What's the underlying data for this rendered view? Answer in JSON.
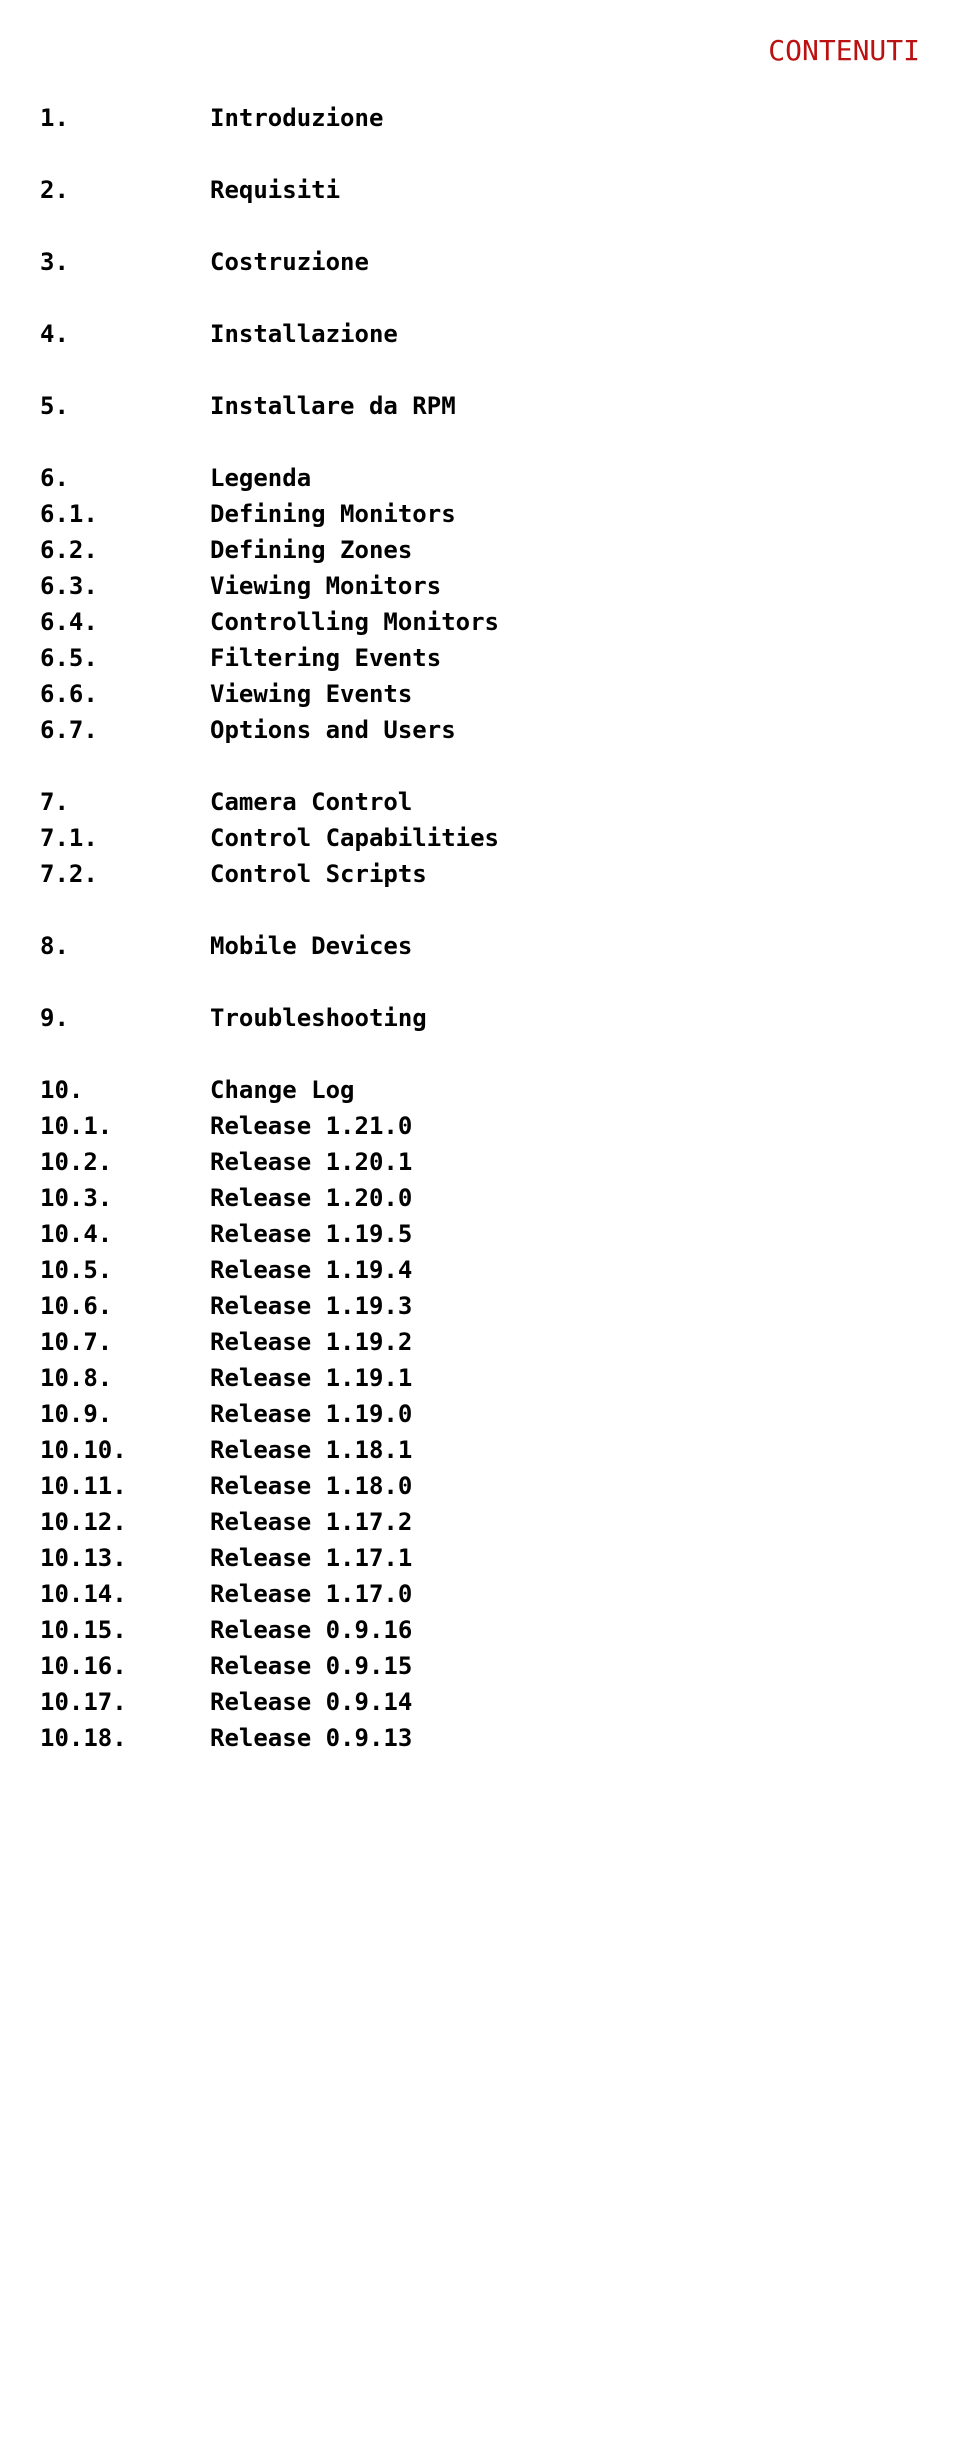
{
  "header": "CONTENUTI",
  "sections": [
    [
      {
        "num": "1.",
        "title": "Introduzione"
      }
    ],
    [
      {
        "num": "2.",
        "title": "Requisiti"
      }
    ],
    [
      {
        "num": "3.",
        "title": "Costruzione"
      }
    ],
    [
      {
        "num": "4.",
        "title": "Installazione"
      }
    ],
    [
      {
        "num": "5.",
        "title": "Installare da RPM"
      }
    ],
    [
      {
        "num": "6.",
        "title": "Legenda"
      },
      {
        "num": "6.1.",
        "title": "Defining Monitors"
      },
      {
        "num": "6.2.",
        "title": "Defining Zones"
      },
      {
        "num": "6.3.",
        "title": "Viewing Monitors"
      },
      {
        "num": "6.4.",
        "title": "Controlling Monitors"
      },
      {
        "num": "6.5.",
        "title": "Filtering Events"
      },
      {
        "num": "6.6.",
        "title": "Viewing Events"
      },
      {
        "num": "6.7.",
        "title": "Options and Users"
      }
    ],
    [
      {
        "num": "7.",
        "title": "Camera Control"
      },
      {
        "num": "7.1.",
        "title": "Control Capabilities"
      },
      {
        "num": "7.2.",
        "title": "Control Scripts"
      }
    ],
    [
      {
        "num": "8.",
        "title": "Mobile Devices"
      }
    ],
    [
      {
        "num": "9.",
        "title": "Troubleshooting"
      }
    ],
    [
      {
        "num": "10.",
        "title": "Change Log"
      },
      {
        "num": "10.1.",
        "title": "Release 1.21.0"
      },
      {
        "num": "10.2.",
        "title": "Release 1.20.1"
      },
      {
        "num": "10.3.",
        "title": "Release 1.20.0"
      },
      {
        "num": "10.4.",
        "title": "Release 1.19.5"
      },
      {
        "num": "10.5.",
        "title": "Release 1.19.4"
      },
      {
        "num": "10.6.",
        "title": "Release 1.19.3"
      },
      {
        "num": "10.7.",
        "title": "Release 1.19.2"
      },
      {
        "num": "10.8.",
        "title": "Release 1.19.1"
      },
      {
        "num": "10.9.",
        "title": "Release 1.19.0"
      },
      {
        "num": "10.10.",
        "title": "Release 1.18.1"
      },
      {
        "num": "10.11.",
        "title": "Release 1.18.0"
      },
      {
        "num": "10.12.",
        "title": "Release 1.17.2"
      },
      {
        "num": "10.13.",
        "title": "Release 1.17.1"
      },
      {
        "num": "10.14.",
        "title": "Release 1.17.0"
      },
      {
        "num": "10.15.",
        "title": "Release 0.9.16"
      },
      {
        "num": "10.16.",
        "title": "Release 0.9.15"
      },
      {
        "num": "10.17.",
        "title": "Release 0.9.14"
      },
      {
        "num": "10.18.",
        "title": "Release 0.9.13"
      }
    ]
  ]
}
